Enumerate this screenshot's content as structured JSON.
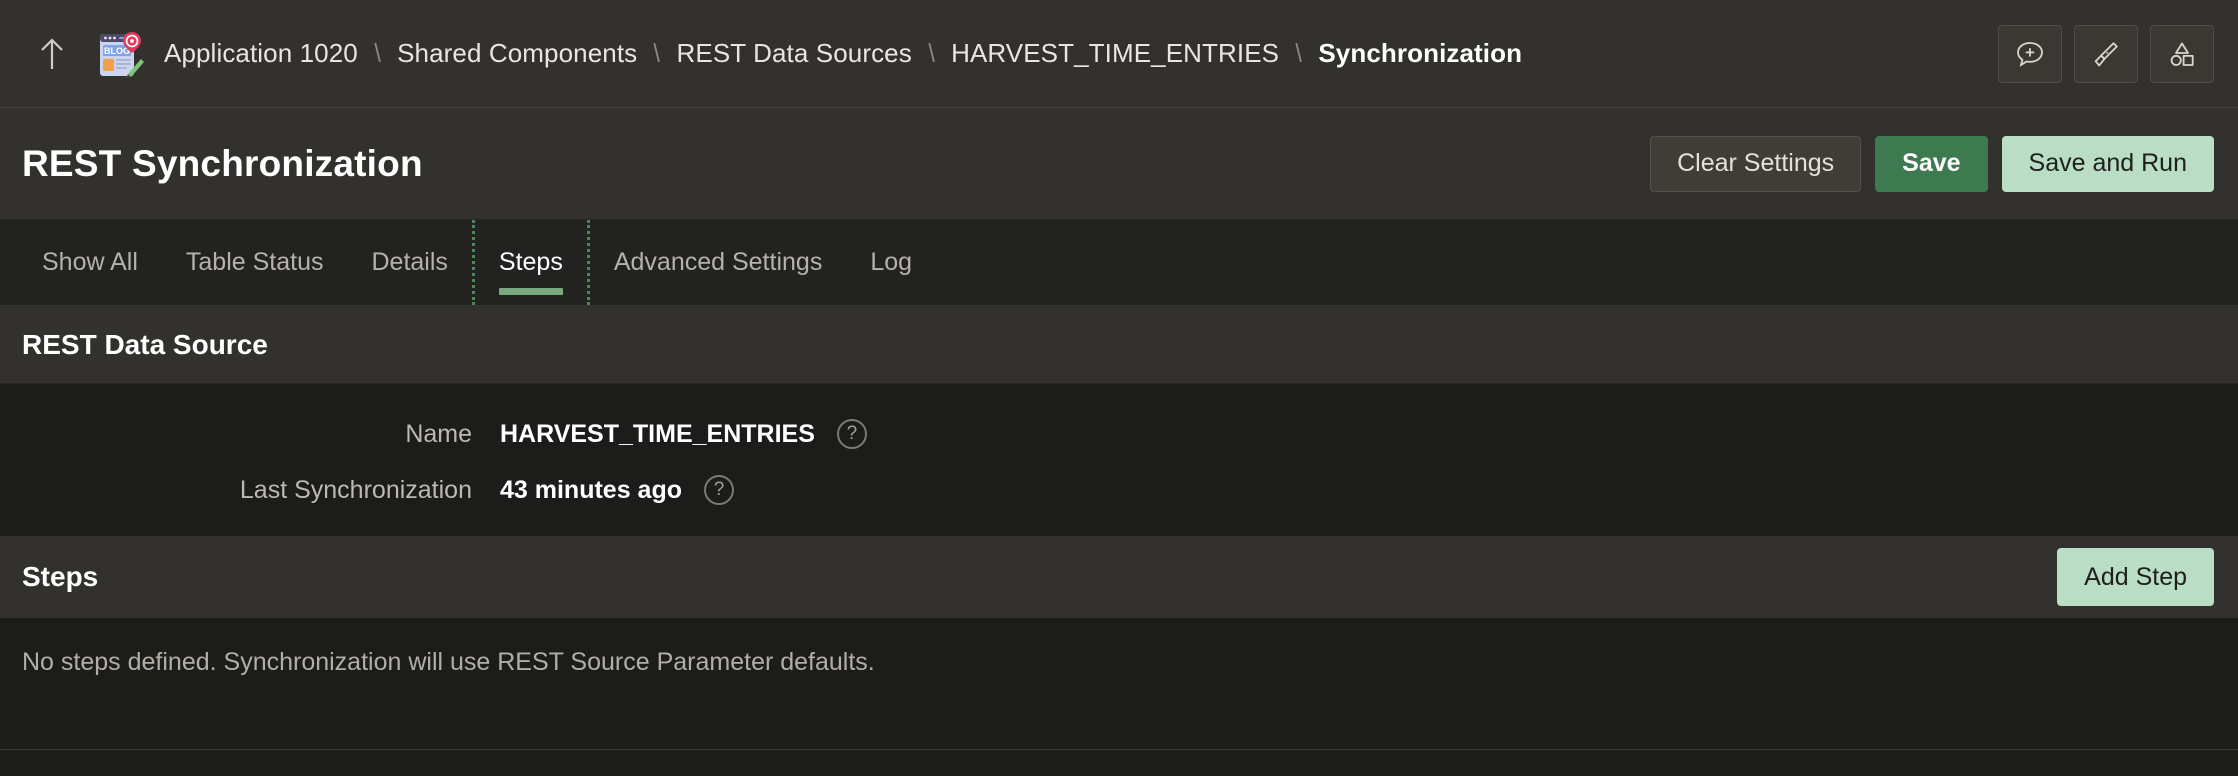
{
  "breadcrumb": {
    "up_icon": "arrow-up-icon",
    "app_icon": "blog-app-icon",
    "items": [
      {
        "label": "Application 1020",
        "current": false
      },
      {
        "label": "Shared Components",
        "current": false
      },
      {
        "label": "REST Data Sources",
        "current": false
      },
      {
        "label": "HARVEST_TIME_ENTRIES",
        "current": false
      },
      {
        "label": "Synchronization",
        "current": true
      }
    ],
    "separator": "\\"
  },
  "header_tools": [
    {
      "name": "add-comment-icon",
      "title": "Add Comment"
    },
    {
      "name": "theme-roller-icon",
      "title": "Theme Roller"
    },
    {
      "name": "shapes-icon",
      "title": "Page Designer Shapes"
    }
  ],
  "title_bar": {
    "title": "REST Synchronization",
    "buttons": [
      {
        "label": "Clear Settings",
        "style": "secondary"
      },
      {
        "label": "Save",
        "style": "save"
      },
      {
        "label": "Save and Run",
        "style": "run"
      }
    ]
  },
  "tabs": {
    "items": [
      {
        "label": "Show All",
        "active": false
      },
      {
        "label": "Table Status",
        "active": false
      },
      {
        "label": "Details",
        "active": false
      },
      {
        "label": "Steps",
        "active": true
      },
      {
        "label": "Advanced Settings",
        "active": false
      },
      {
        "label": "Log",
        "active": false
      }
    ]
  },
  "rest_data_source": {
    "section_title": "REST Data Source",
    "fields": [
      {
        "label": "Name",
        "value": "HARVEST_TIME_ENTRIES",
        "help": "?"
      },
      {
        "label": "Last Synchronization",
        "value": "43 minutes ago",
        "help": "?"
      }
    ]
  },
  "steps": {
    "section_title": "Steps",
    "add_button_label": "Add Step",
    "empty_message": "No steps defined. Synchronization will use REST Source Parameter defaults."
  },
  "colors": {
    "page_background": "#1c1c1a",
    "bar_background": "#33312d",
    "tabs_background": "#222220",
    "accent_green": "#79a97f",
    "save_green": "#3d7a4f",
    "mint_green": "#b9ddc5",
    "text_primary": "#ffffff",
    "text_muted": "#b6b2aa"
  }
}
